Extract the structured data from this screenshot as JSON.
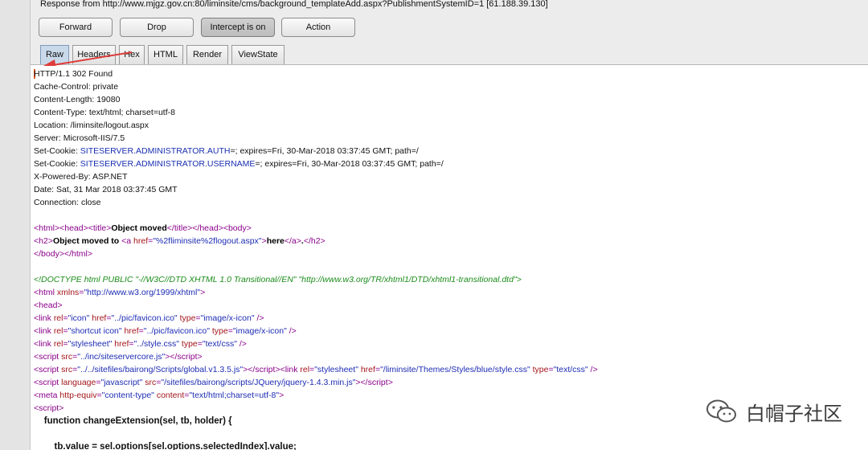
{
  "response_bar": "Response from http://www.mjgz.gov.cn:80/liminsite/cms/background_templateAdd.aspx?PublishmentSystemID=1  [61.188.39.130]",
  "buttons": [
    "Forward",
    "Drop",
    "Intercept is on",
    "Action"
  ],
  "tabs": [
    "Raw",
    "Headers",
    "Hex",
    "HTML",
    "Render",
    "ViewState"
  ],
  "selected_tab": "Raw",
  "headers": {
    "status": "HTTP/1.1 302 Found",
    "cache_control": "Cache-Control: private",
    "content_length": "Content-Length: 19080",
    "content_type": "Content-Type: text/html; charset=utf-8",
    "location": "Location: /liminsite/logout.aspx",
    "server": "Server: Microsoft-IIS/7.5",
    "set_cookie_label": "Set-Cookie: ",
    "cookie1_name": "SITESERVER.ADMINISTRATOR.AUTH",
    "cookie1_rest": "=; expires=Fri, 30-Mar-2018 03:37:45 GMT; path=/",
    "cookie2_name": "SITESERVER.ADMINISTRATOR.USERNAME",
    "cookie2_rest": "=; expires=Fri, 30-Mar-2018 03:37:45 GMT; path=/",
    "powered_by": "X-Powered-By: ASP.NET",
    "date": "Date: Sat, 31 Mar 2018 03:37:45 GMT",
    "connection": "Connection: close"
  },
  "body": {
    "title_text": "Object moved",
    "h2_text": "Object moved to ",
    "href_value": "\"%2fliminsite%2flogout.aspx\"",
    "here": "here",
    "period": ".",
    "doctype": "<!DOCTYPE html PUBLIC \"-//W3C//DTD XHTML 1.0 Transitional//EN\" \"http://www.w3.org/TR/xhtml1/DTD/xhtml1-transitional.dtd\">",
    "xmlns_value": "\"http://www.w3.org/1999/xhtml\"",
    "icon_href": "\"../pic/favicon.ico\"",
    "icon_type": "\"image/x-icon\"",
    "shortcut_href": "\"../pic/favicon.ico\"",
    "shortcut_type": "\"image/x-icon\"",
    "style_href": "\"../style.css\"",
    "text_css": "\"text/css\"",
    "script1_src": "\"../inc/siteservercore.js\"",
    "script2_src": "\"../../sitefiles/bairong/Scripts/global.v1.3.5.js\"",
    "theme_href": "\"/liminsite/Themes/Styles/blue/style.css\"",
    "script3_src": "\"/sitefiles/bairong/scripts/JQuery/jquery-1.4.3.min.js\"",
    "meta_content": "\"text/html;charset=utf-8\"",
    "js_func": "    function changeExtension(sel, tb, holder) {",
    "js_line": "        tb.value = sel.options[sel.options.selectedIndex].value;"
  },
  "watermark": "白帽子社区"
}
